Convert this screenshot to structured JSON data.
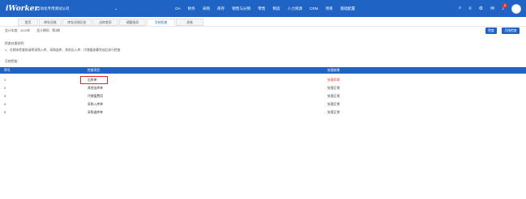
{
  "app": {
    "brand": "iWorker",
    "company": "自动化专用测试公司",
    "caret": "⌄"
  },
  "main_nav": [
    "OA",
    "财务",
    "采购",
    "库存",
    "销售与分销",
    "零售",
    "制造",
    "人力资源",
    "CRM",
    "项目",
    "基础配置"
  ],
  "top_icons": {
    "search": "⌕",
    "menu": "≡",
    "settings": "⚙",
    "chat": "✉",
    "bell": "♪",
    "bell_badge": "8"
  },
  "tabs": [
    {
      "label": "首页",
      "active": false
    },
    {
      "label": "库存总账",
      "active": false
    },
    {
      "label": "库存总账历史",
      "active": false
    },
    {
      "label": "出库差异",
      "active": false
    },
    {
      "label": "调整指导",
      "active": false
    },
    {
      "label": "月结检查",
      "active": true
    },
    {
      "label": "关账",
      "active": false
    }
  ],
  "info": {
    "year_label": "会计年度：2019年",
    "period_label": "会计期间：第3期"
  },
  "buttons": {
    "check": "检查",
    "close": "月结检查"
  },
  "notes": {
    "title": "检查处理说明：",
    "line1": "1、在期末检查前请将采购入库、采购退库、其他出入库、代储值核算完成后执行检查"
  },
  "section_title": "月结检查：",
  "table": {
    "headers": {
      "index": "序号",
      "item": "检查项目",
      "result": "处理结果"
    },
    "rows": [
      {
        "index": "1",
        "item": "出库单",
        "result": "处理异常",
        "bad": true
      },
      {
        "index": "2",
        "item": "其他出库单",
        "result": "处理正常",
        "bad": false
      },
      {
        "index": "3",
        "item": "代储值费用",
        "result": "处理正常",
        "bad": false
      },
      {
        "index": "4",
        "item": "采购入库单",
        "result": "处理正常",
        "bad": false
      },
      {
        "index": "5",
        "item": "采购退库单",
        "result": "处理正常",
        "bad": false
      }
    ]
  },
  "colors": {
    "primary": "#1f63c5",
    "error": "#e12b2b"
  }
}
